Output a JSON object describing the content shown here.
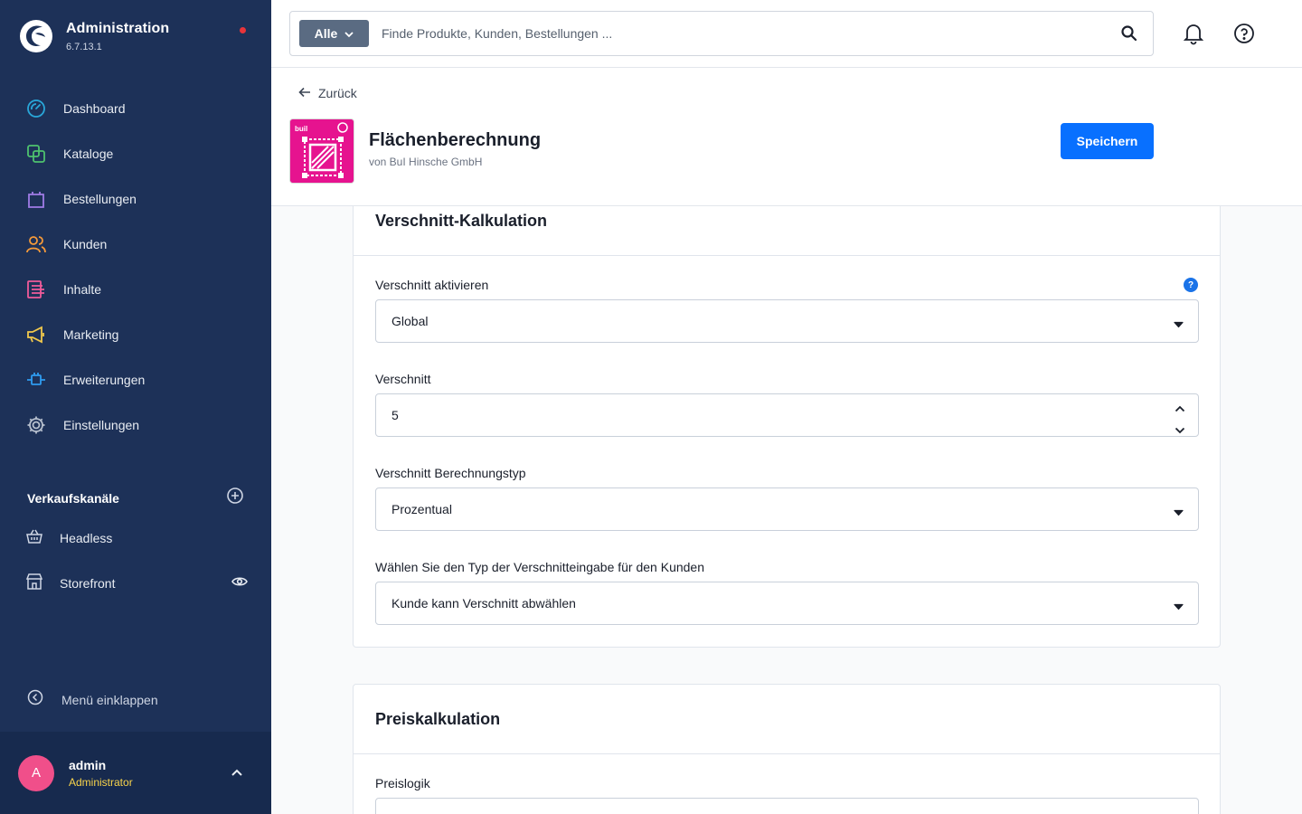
{
  "app": {
    "title": "Administration",
    "version": "6.7.13.1"
  },
  "sidebar": {
    "items": [
      {
        "label": "Dashboard",
        "icon": "dashboard-icon",
        "color": "#29a7d9"
      },
      {
        "label": "Kataloge",
        "icon": "catalog-icon",
        "color": "#4ec26e"
      },
      {
        "label": "Bestellungen",
        "icon": "shopping-bag-icon",
        "color": "#a07ce6"
      },
      {
        "label": "Kunden",
        "icon": "customers-icon",
        "color": "#f59a3a"
      },
      {
        "label": "Inhalte",
        "icon": "content-icon",
        "color": "#f05b9a"
      },
      {
        "label": "Marketing",
        "icon": "megaphone-icon",
        "color": "#f2c94c"
      },
      {
        "label": "Erweiterungen",
        "icon": "plugin-icon",
        "color": "#2f9cf0"
      },
      {
        "label": "Einstellungen",
        "icon": "gear-icon",
        "color": "#b7c0ce"
      }
    ],
    "sales_channels": {
      "title": "Verkaufskanäle",
      "items": [
        {
          "label": "Headless",
          "icon": "basket-icon"
        },
        {
          "label": "Storefront",
          "icon": "storefront-icon"
        }
      ]
    },
    "collapse_label": "Menü einklappen",
    "user": {
      "initial": "A",
      "name": "admin",
      "role": "Administrator"
    }
  },
  "search": {
    "type_label": "Alle",
    "placeholder": "Finde Produkte, Kunden, Bestellungen ..."
  },
  "header": {
    "back_label": "Zurück",
    "plugin_title": "Flächenberechnung",
    "plugin_vendor": "von BuI Hinsche GmbH",
    "save_label": "Speichern",
    "plugin_icon_text": "buil"
  },
  "cards": {
    "verschnitt": {
      "title": "Verschnitt-Kalkulation",
      "fields": [
        {
          "label": "Verschnitt aktivieren",
          "value": "Global"
        },
        {
          "label": "Verschnitt",
          "value": "5"
        },
        {
          "label": "Verschnitt Berechnungstyp",
          "value": "Prozentual"
        },
        {
          "label": "Wählen Sie den Typ der Verschnitteingabe für den Kunden",
          "value": "Kunde kann Verschnitt abwählen"
        }
      ],
      "help_mark": "?"
    },
    "preis": {
      "title": "Preiskalkulation",
      "fields": [
        {
          "label": "Preislogik",
          "value": ""
        }
      ]
    }
  },
  "colors": {
    "sidebar_bg": "#1d3158",
    "primary": "#0870ff",
    "plugin_icon_bg": "#e6138f",
    "user_role": "#f9d44b",
    "notification_dot": "#e8343a"
  }
}
